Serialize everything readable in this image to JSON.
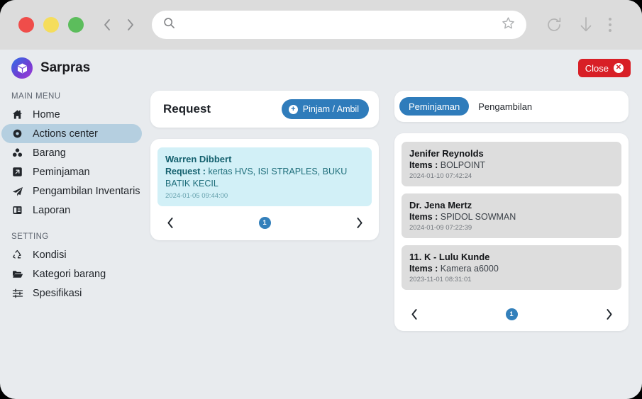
{
  "browser": {
    "back_icon": "chevron-left-icon",
    "forward_icon": "chevron-right-icon",
    "search_icon": "search-icon",
    "url_value": "",
    "url_placeholder": "",
    "bookmark_icon": "star-icon",
    "reload_icon": "reload-icon",
    "download_icon": "download-arrow-icon",
    "menu_icon": "kebab-menu-icon"
  },
  "header": {
    "brand": "Sarpras",
    "logo_icon": "cube-logo-icon",
    "close_label": "Close",
    "close_icon": "close-circle-icon",
    "close_color": "#d81f26"
  },
  "sidebar": {
    "main_title": "MAIN MENU",
    "setting_title": "SETTING",
    "main_items": [
      {
        "label": "Home",
        "icon": "home-icon",
        "active": false
      },
      {
        "label": "Actions center",
        "icon": "target-circle-icon",
        "active": true
      },
      {
        "label": "Barang",
        "icon": "cubes-icon",
        "active": false
      },
      {
        "label": "Peminjaman",
        "icon": "external-link-box-icon",
        "active": false
      },
      {
        "label": "Pengambilan Inventaris",
        "icon": "paper-plane-icon",
        "active": false
      },
      {
        "label": "Laporan",
        "icon": "report-book-icon",
        "active": false
      }
    ],
    "setting_items": [
      {
        "label": "Kondisi",
        "icon": "recycle-icon"
      },
      {
        "label": "Kategori barang",
        "icon": "folder-open-icon"
      },
      {
        "label": "Spesifikasi",
        "icon": "sliders-icon"
      }
    ],
    "active_color": "#b5cfe0"
  },
  "request_panel": {
    "title": "Request",
    "action_label": "Pinjam / Ambil",
    "action_icon": "plus-circle-icon",
    "action_color": "#2f7cbb",
    "items": [
      {
        "name": "Warren Dibbert",
        "field_label": "Request :",
        "field_value": "kertas HVS, ISI STRAPLES, BUKU BATIK KECIL",
        "date": "2024-01-05 09:44:00"
      }
    ],
    "pager": {
      "prev_icon": "chevron-left-icon",
      "next_icon": "chevron-right-icon",
      "page": "1"
    }
  },
  "loan_panel": {
    "tabs": [
      {
        "label": "Peminjaman",
        "active": true
      },
      {
        "label": "Pengambilan",
        "active": false
      }
    ],
    "tab_active_color": "#2f7cbb",
    "items": [
      {
        "name": "Jenifer Reynolds",
        "field_label": "Items :",
        "field_value": "BOLPOINT",
        "date": "2024-01-10 07:42:24"
      },
      {
        "name": "Dr. Jena Mertz",
        "field_label": "Items :",
        "field_value": "SPIDOL SOWMAN",
        "date": "2024-01-09 07:22:39"
      },
      {
        "name": "11. K - Lulu Kunde",
        "field_label": "Items :",
        "field_value": "Kamera a6000",
        "date": "2023-11-01 08:31:01"
      }
    ],
    "pager": {
      "prev_icon": "chevron-left-icon",
      "next_icon": "chevron-right-icon",
      "page": "1"
    }
  }
}
